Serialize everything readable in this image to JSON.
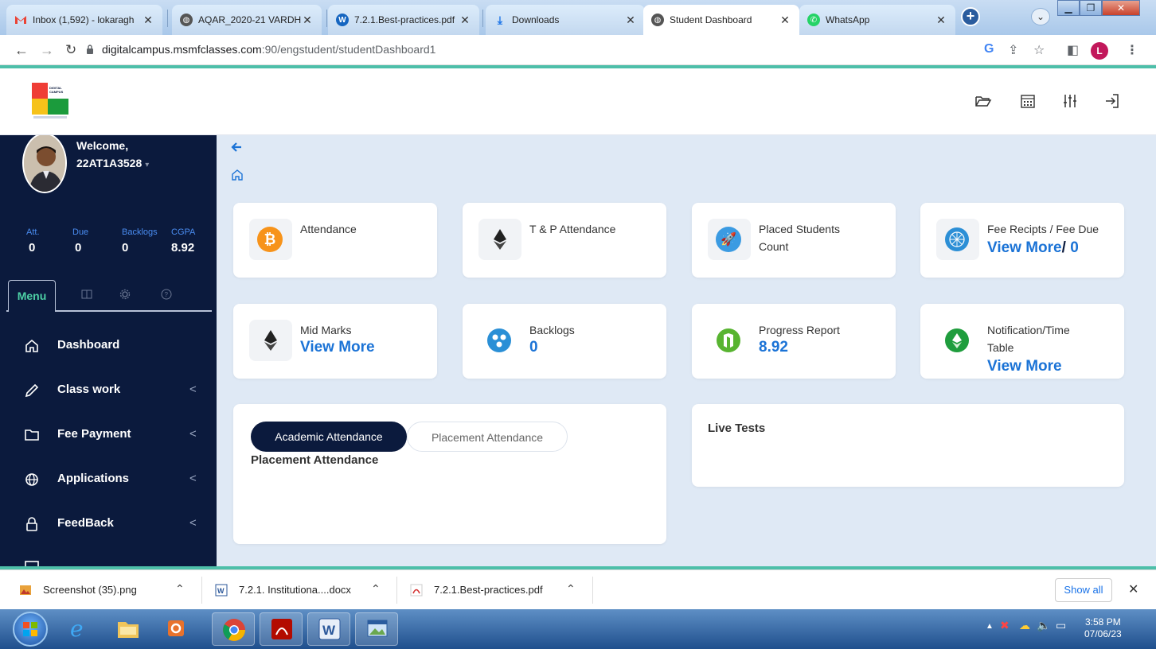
{
  "browser": {
    "tabs": [
      {
        "label": "Inbox (1,592) - lokaragh",
        "favicon": "gmail-icon",
        "favicon_color": "#ea4335",
        "active": false
      },
      {
        "label": "AQAR_2020-21 VARDH",
        "favicon": "globe-icon",
        "favicon_color": "#555555",
        "active": false
      },
      {
        "label": "7.2.1.Best-practices.pdf",
        "favicon": "wordpress-icon",
        "favicon_color": "#1565c0",
        "active": false
      },
      {
        "label": "Downloads",
        "favicon": "download-icon",
        "favicon_color": "#1a73e8",
        "active": false
      },
      {
        "label": "Student Dashboard",
        "favicon": "globe-icon",
        "favicon_color": "#555555",
        "active": true
      },
      {
        "label": "WhatsApp",
        "favicon": "whatsapp-icon",
        "favicon_color": "#25d366",
        "active": false
      }
    ],
    "new_tab": "+",
    "url_host": "digitalcampus.msmfclasses.com",
    "url_path": ":90/engstudent/studentDashboard1",
    "profile_initial": "L"
  },
  "header": {
    "logo_text": "DIGITAL CAMPUS"
  },
  "sidebar": {
    "welcome": "Welcome,",
    "user_id": "22AT1A3528",
    "stats": [
      {
        "label": "Att.",
        "value": "0"
      },
      {
        "label": "Due",
        "value": "0"
      },
      {
        "label": "Backlogs",
        "value": "0"
      },
      {
        "label": "CGPA",
        "value": "8.92"
      }
    ],
    "menu_tab": "Menu",
    "items": [
      {
        "label": "Dashboard",
        "icon": "home-icon"
      },
      {
        "label": "Class work",
        "icon": "pencil-icon"
      },
      {
        "label": "Fee Payment",
        "icon": "folder-icon"
      },
      {
        "label": "Applications",
        "icon": "globe-icon"
      },
      {
        "label": "FeedBack",
        "icon": "lock-icon"
      }
    ]
  },
  "cards": {
    "attendance": {
      "title": "Attendance"
    },
    "tp_attendance": {
      "title": "T & P Attendance"
    },
    "placed": {
      "title_l1": "Placed Students",
      "title_l2": "Count"
    },
    "fee": {
      "title": "Fee Recipts / Fee Due",
      "value_link": "View More",
      "value_sep": "/",
      "value_due": "0"
    },
    "mid_marks": {
      "title": "Mid Marks",
      "value": "View More"
    },
    "backlogs": {
      "title": "Backlogs",
      "value": "0"
    },
    "progress": {
      "title": "Progress Report",
      "value": "8.92"
    },
    "notification": {
      "title_l1": "Notification/Time",
      "title_l2": "Table",
      "value": "View More"
    }
  },
  "attendance_panel": {
    "tab_academic": "Academic Attendance",
    "tab_placement": "Placement Attendance",
    "subtitle": "Placement Attendance"
  },
  "live_tests": {
    "title": "Live Tests"
  },
  "downloads": {
    "items": [
      {
        "name": "Screenshot (35).png"
      },
      {
        "name": "7.2.1. Institutiona....docx"
      },
      {
        "name": "7.2.1.Best-practices.pdf"
      }
    ],
    "show_all": "Show all"
  },
  "taskbar": {
    "time": "3:58 PM",
    "date": "07/06/23"
  },
  "colors": {
    "sidebar_bg": "#0b1a3d",
    "accent_teal": "#4dbfa9",
    "link_blue": "#1b73d6",
    "stat_label_blue": "#4a8cf0"
  }
}
